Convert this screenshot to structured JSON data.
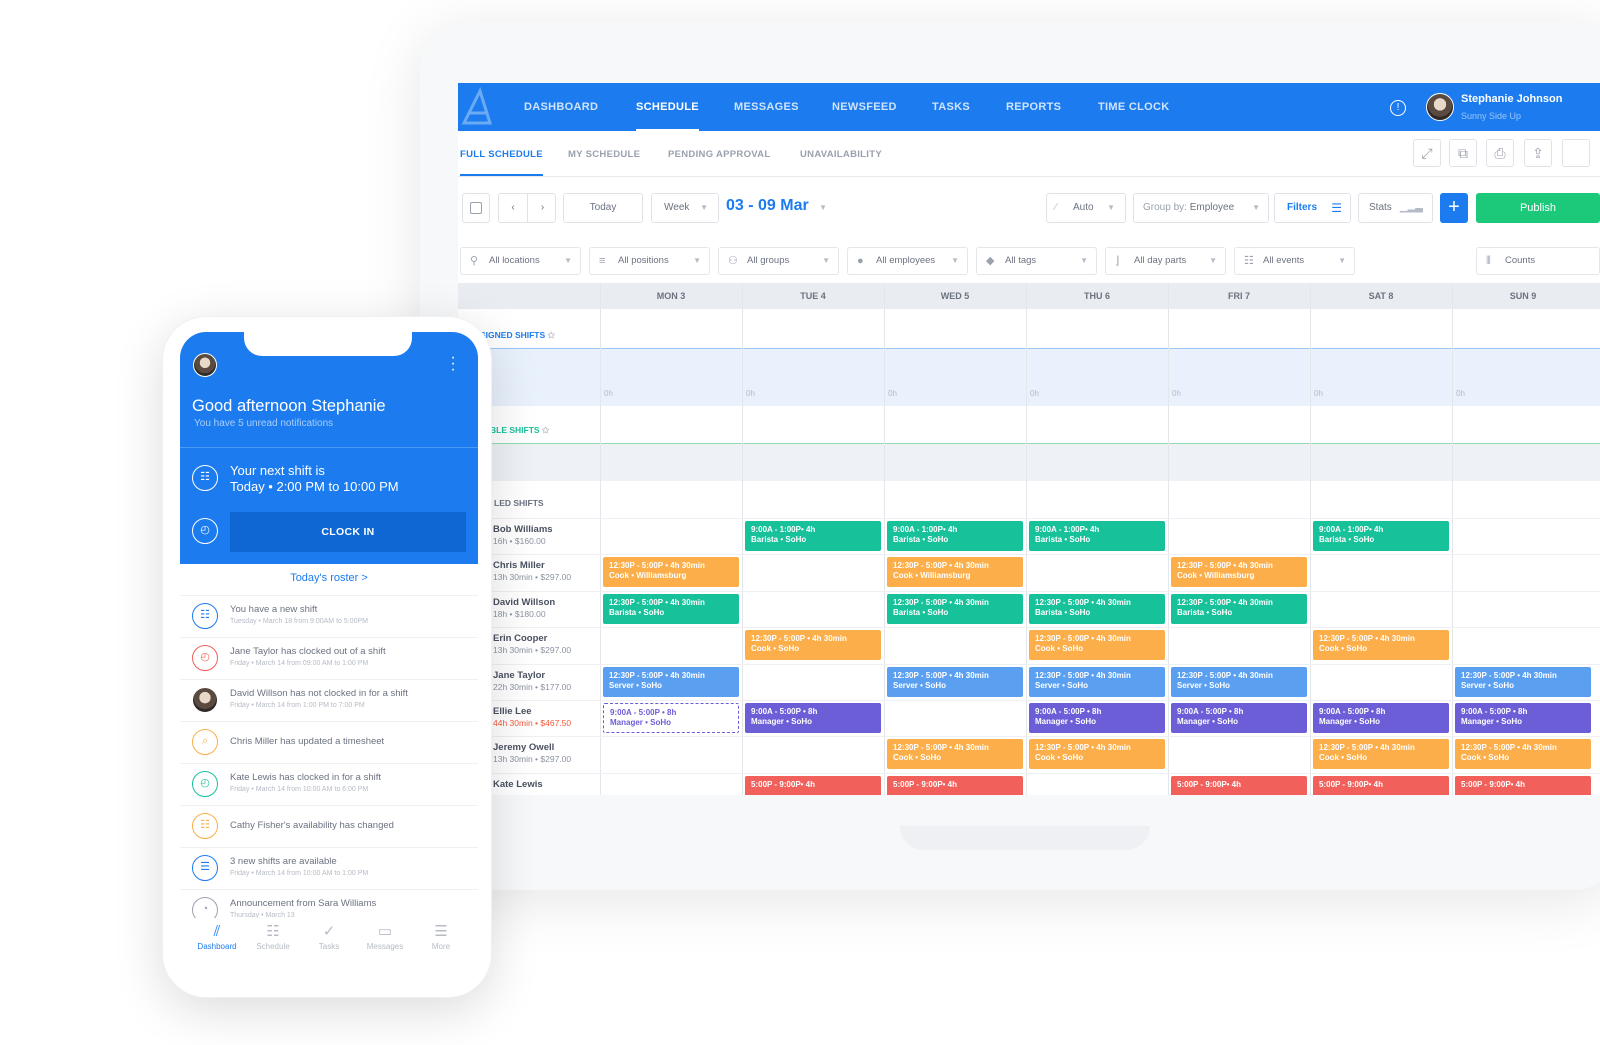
{
  "nav": {
    "items": [
      "DASHBOARD",
      "SCHEDULE",
      "MESSAGES",
      "NEWSFEED",
      "TASKS",
      "REPORTS",
      "TIME CLOCK"
    ],
    "active": "SCHEDULE",
    "user_name": "Stephanie Johnson",
    "user_org": "Sunny Side Up"
  },
  "subnav": {
    "items": [
      "FULL SCHEDULE",
      "MY SCHEDULE",
      "PENDING APPROVAL",
      "UNAVAILABILITY"
    ],
    "active": "FULL SCHEDULE"
  },
  "toolbar": {
    "today": "Today",
    "view": "Week",
    "date_range": "03 - 09 Mar",
    "auto": "Auto",
    "group_by_label": "Group by:",
    "group_by_value": "Employee",
    "filters": "Filters",
    "stats": "Stats",
    "add": "+",
    "publish": "Publish"
  },
  "filters": {
    "locations": "All locations",
    "positions": "All positions",
    "groups": "All groups",
    "employees": "All employees",
    "tags": "All tags",
    "day_parts": "All day parts",
    "events": "All events",
    "counts": "Counts"
  },
  "days": [
    "MON 3",
    "TUE 4",
    "WED 5",
    "THU 6",
    "FRI 7",
    "SAT 8",
    "SUN 9"
  ],
  "sections": {
    "unassigned": "SIGNED SHIFTS",
    "available": "BLE SHIFTS",
    "scheduled": "LED SHIFTS",
    "zero_hours": "0h"
  },
  "employees": [
    {
      "name": "Bob Williams",
      "meta": "16h • $160.00",
      "over": false
    },
    {
      "name": "Chris Miller",
      "meta": "13h 30min • $297.00",
      "over": false
    },
    {
      "name": "David Willson",
      "meta": "18h • $180.00",
      "over": false
    },
    {
      "name": "Erin Cooper",
      "meta": "13h 30min • $297.00",
      "over": false
    },
    {
      "name": "Jane Taylor",
      "meta": "22h 30min • $177.00",
      "over": false
    },
    {
      "name": "Ellie Lee",
      "meta": "44h 30min • $467.50",
      "over": true
    },
    {
      "name": "Jeremy Owell",
      "meta": "13h 30min • $297.00",
      "over": false
    },
    {
      "name": "Kate Lewis",
      "meta": "",
      "over": false
    }
  ],
  "shifts": [
    {
      "row": 0,
      "day": 1,
      "time": "9:00A - 1:00P• 4h",
      "role": "Barista • SoHo",
      "color": "green"
    },
    {
      "row": 0,
      "day": 2,
      "time": "9:00A - 1:00P• 4h",
      "role": "Barista • SoHo",
      "color": "green"
    },
    {
      "row": 0,
      "day": 3,
      "time": "9:00A - 1:00P• 4h",
      "role": "Barista • SoHo",
      "color": "green"
    },
    {
      "row": 0,
      "day": 5,
      "time": "9:00A - 1:00P• 4h",
      "role": "Barista • SoHo",
      "color": "green"
    },
    {
      "row": 1,
      "day": 0,
      "time": "12:30P - 5:00P • 4h 30min",
      "role": "Cook • Williamsburg",
      "color": "orange"
    },
    {
      "row": 1,
      "day": 2,
      "time": "12:30P - 5:00P • 4h 30min",
      "role": "Cook • Williamsburg",
      "color": "orange"
    },
    {
      "row": 1,
      "day": 4,
      "time": "12:30P - 5:00P • 4h 30min",
      "role": "Cook • Williamsburg",
      "color": "orange"
    },
    {
      "row": 2,
      "day": 0,
      "time": "12:30P - 5:00P • 4h 30min",
      "role": "Barista • SoHo",
      "color": "green"
    },
    {
      "row": 2,
      "day": 2,
      "time": "12:30P - 5:00P • 4h 30min",
      "role": "Barista • SoHo",
      "color": "green"
    },
    {
      "row": 2,
      "day": 3,
      "time": "12:30P - 5:00P • 4h 30min",
      "role": "Barista • SoHo",
      "color": "green"
    },
    {
      "row": 2,
      "day": 4,
      "time": "12:30P - 5:00P • 4h 30min",
      "role": "Barista • SoHo",
      "color": "green"
    },
    {
      "row": 3,
      "day": 1,
      "time": "12:30P - 5:00P • 4h 30min",
      "role": "Cook • SoHo",
      "color": "orange"
    },
    {
      "row": 3,
      "day": 3,
      "time": "12:30P - 5:00P • 4h 30min",
      "role": "Cook • SoHo",
      "color": "orange"
    },
    {
      "row": 3,
      "day": 5,
      "time": "12:30P - 5:00P • 4h 30min",
      "role": "Cook • SoHo",
      "color": "orange"
    },
    {
      "row": 4,
      "day": 0,
      "time": "12:30P - 5:00P • 4h 30min",
      "role": "Server • SoHo",
      "color": "blue"
    },
    {
      "row": 4,
      "day": 2,
      "time": "12:30P - 5:00P • 4h 30min",
      "role": "Server • SoHo",
      "color": "blue"
    },
    {
      "row": 4,
      "day": 3,
      "time": "12:30P - 5:00P • 4h 30min",
      "role": "Server • SoHo",
      "color": "blue"
    },
    {
      "row": 4,
      "day": 4,
      "time": "12:30P - 5:00P • 4h 30min",
      "role": "Server • SoHo",
      "color": "blue"
    },
    {
      "row": 4,
      "day": 6,
      "time": "12:30P - 5:00P • 4h 30min",
      "role": "Server • SoHo",
      "color": "blue"
    },
    {
      "row": 5,
      "day": 0,
      "time": "9:00A - 5:00P • 8h",
      "role": "Manager • SoHo",
      "color": "dashed"
    },
    {
      "row": 5,
      "day": 1,
      "time": "9:00A - 5:00P • 8h",
      "role": "Manager • SoHo",
      "color": "purple"
    },
    {
      "row": 5,
      "day": 3,
      "time": "9:00A - 5:00P • 8h",
      "role": "Manager • SoHo",
      "color": "purple"
    },
    {
      "row": 5,
      "day": 4,
      "time": "9:00A - 5:00P • 8h",
      "role": "Manager • SoHo",
      "color": "purple"
    },
    {
      "row": 5,
      "day": 5,
      "time": "9:00A - 5:00P • 8h",
      "role": "Manager • SoHo",
      "color": "purple"
    },
    {
      "row": 5,
      "day": 6,
      "time": "9:00A - 5:00P • 8h",
      "role": "Manager • SoHo",
      "color": "purple"
    },
    {
      "row": 6,
      "day": 2,
      "time": "12:30P - 5:00P • 4h 30min",
      "role": "Cook • SoHo",
      "color": "orange"
    },
    {
      "row": 6,
      "day": 3,
      "time": "12:30P - 5:00P • 4h 30min",
      "role": "Cook • SoHo",
      "color": "orange"
    },
    {
      "row": 6,
      "day": 5,
      "time": "12:30P - 5:00P • 4h 30min",
      "role": "Cook • SoHo",
      "color": "orange"
    },
    {
      "row": 6,
      "day": 6,
      "time": "12:30P - 5:00P • 4h 30min",
      "role": "Cook • SoHo",
      "color": "orange"
    },
    {
      "row": 7,
      "day": 1,
      "time": "5:00P - 9:00P• 4h",
      "role": "",
      "color": "red"
    },
    {
      "row": 7,
      "day": 2,
      "time": "5:00P - 9:00P• 4h",
      "role": "",
      "color": "red"
    },
    {
      "row": 7,
      "day": 4,
      "time": "5:00P - 9:00P• 4h",
      "role": "",
      "color": "red"
    },
    {
      "row": 7,
      "day": 5,
      "time": "5:00P - 9:00P• 4h",
      "role": "",
      "color": "red"
    },
    {
      "row": 7,
      "day": 6,
      "time": "5:00P - 9:00P• 4h",
      "role": "",
      "color": "red"
    }
  ],
  "colors": {
    "brand_blue": "#1c7cef",
    "publish_green": "#1cc87a",
    "shift_green": "#17c19a",
    "shift_orange": "#fbae4a",
    "shift_blue": "#5b9ff0",
    "shift_purple": "#6c5ed6",
    "shift_red": "#f1605a"
  },
  "phone": {
    "greeting": "Good afternoon Stephanie",
    "notifications": "You have 5 unread notifications",
    "next_shift_line1": "Your next shift is",
    "next_shift_line2": "Today • 2:00 PM to 10:00 PM",
    "clock_in": "CLOCK IN",
    "roster_link": "Today's roster >",
    "feed": [
      {
        "title": "You have a new shift",
        "sub": "Tuesday • March 18 from 9:00AM to 5:00PM",
        "icon": "calendar-icon",
        "color": "#1c7cef"
      },
      {
        "title": "Jane Taylor has clocked out of a shift",
        "sub": "Friday • March 14 from 09:00 AM to 1:00 PM",
        "icon": "clock-icon",
        "color": "#f1605a"
      },
      {
        "title": "David Willson has not clocked in for a shift",
        "sub": "Friday • March 14 from 1:00 PM to 7:00 PM",
        "icon": "avatar",
        "color": "#5a4a40"
      },
      {
        "title": "Chris Miller has updated a timesheet",
        "sub": "",
        "icon": "timesheet-icon",
        "color": "#fbae4a"
      },
      {
        "title": "Kate Lewis has clocked in for a shift",
        "sub": "Friday • March 14 from 10:00 AM to 6:00 PM",
        "icon": "clock-icon",
        "color": "#17c19a"
      },
      {
        "title": "Cathy Fisher's availability has changed",
        "sub": "",
        "icon": "availability-icon",
        "color": "#fbae4a"
      },
      {
        "title": "3 new shifts are available",
        "sub": "Friday • March 14 from 10:00 AM to 1:00 PM",
        "icon": "shifts-available-icon",
        "color": "#1c7cef"
      },
      {
        "title": "Announcement from Sara Williams",
        "sub": "Thursday • March 13",
        "icon": "announcement-icon",
        "color": "#9aa1ad"
      }
    ],
    "tabs": [
      {
        "label": "Dashboard",
        "icon": "dashboard-icon",
        "active": true
      },
      {
        "label": "Schedule",
        "icon": "schedule-icon",
        "active": false
      },
      {
        "label": "Tasks",
        "icon": "tasks-icon",
        "active": false
      },
      {
        "label": "Messages",
        "icon": "messages-icon",
        "active": false
      },
      {
        "label": "More",
        "icon": "more-icon",
        "active": false
      }
    ]
  }
}
